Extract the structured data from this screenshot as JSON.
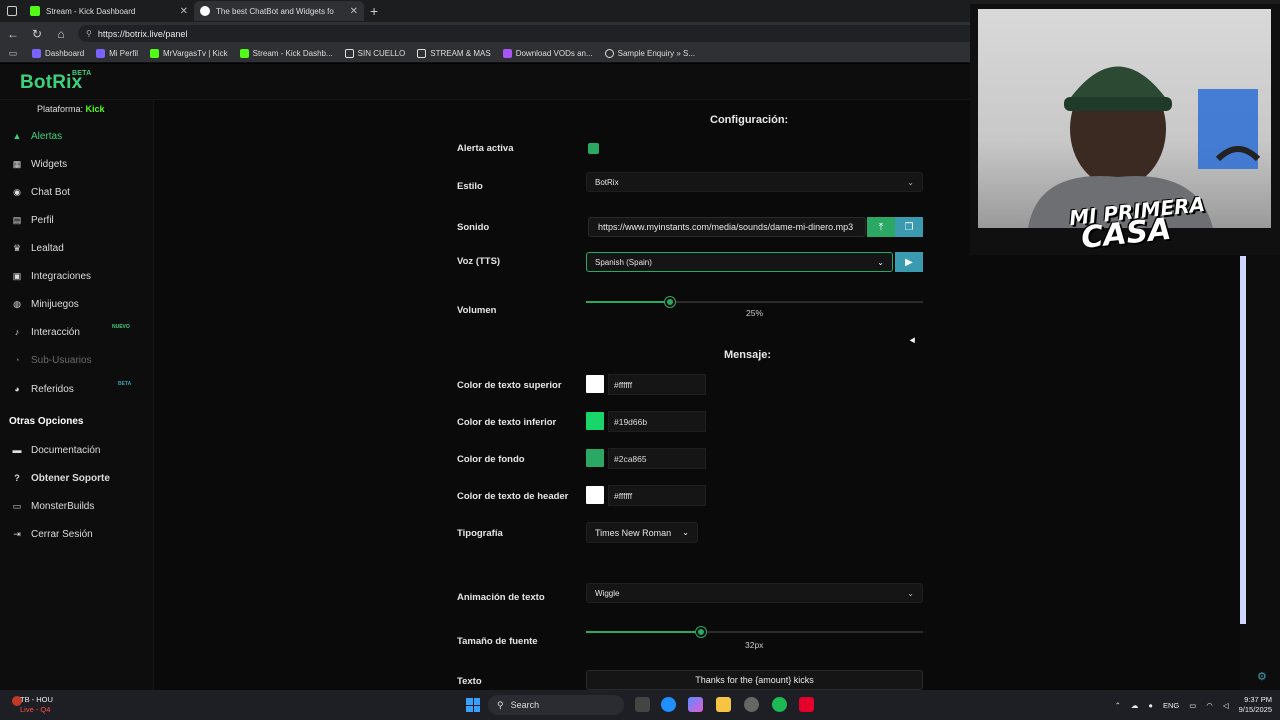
{
  "browser": {
    "tabs": [
      {
        "title": "Stream - Kick Dashboard",
        "favicon_color": "#53fc18"
      },
      {
        "title": "The best ChatBot and Widgets fo",
        "favicon_color": "#ffffff"
      }
    ],
    "url": "https://botrix.live/panel",
    "bookmarks": [
      {
        "label": "Dashboard",
        "icon": "botrix-icon",
        "color": "#7b61ff"
      },
      {
        "label": "Mi Perfil",
        "icon": "botrix-icon",
        "color": "#7b61ff"
      },
      {
        "label": "MrVargasTv | Kick",
        "icon": "kick-icon",
        "color": "#53fc18"
      },
      {
        "label": "Stream - Kick Dashb...",
        "icon": "kick-icon",
        "color": "#53fc18"
      },
      {
        "label": "SIN CUELLO",
        "icon": "folder-icon",
        "color": "#dddddd"
      },
      {
        "label": "STREAM & MAS",
        "icon": "folder-icon",
        "color": "#dddddd"
      },
      {
        "label": "Download VODs an...",
        "icon": "download-icon",
        "color": "#a855f7"
      },
      {
        "label": "Sample Enquiry » S...",
        "icon": "globe-icon",
        "color": "#dddddd"
      }
    ]
  },
  "app": {
    "logo": "BotRix",
    "logo_badge": "BETA",
    "platform_label": "Plataforma:",
    "platform_value": "Kick",
    "brand_color": "#2ca865"
  },
  "sidebar": {
    "items": [
      {
        "label": "Alertas",
        "icon": "alert-icon",
        "state": "active"
      },
      {
        "label": "Widgets",
        "icon": "widgets-icon"
      },
      {
        "label": "Chat Bot",
        "icon": "robot-icon"
      },
      {
        "label": "Perfil",
        "icon": "profile-icon"
      },
      {
        "label": "Lealtad",
        "icon": "trophy-icon"
      },
      {
        "label": "Integraciones",
        "icon": "integrations-icon"
      },
      {
        "label": "Minijuegos",
        "icon": "gamepad-icon"
      },
      {
        "label": "Interacción",
        "icon": "interaction-icon",
        "badge": "NUEVO"
      },
      {
        "label": "Sub-Usuarios",
        "icon": "users-icon",
        "state": "disabled"
      },
      {
        "label": "Referidos",
        "icon": "referrals-icon",
        "badge": "BETA"
      }
    ],
    "section_title": "Otras Opciones",
    "other": [
      {
        "label": "Documentación",
        "icon": "document-icon"
      },
      {
        "label": "Obtener Soporte",
        "icon": "help-icon"
      },
      {
        "label": "MonsterBuilds",
        "icon": "laptop-icon"
      },
      {
        "label": "Cerrar Sesión",
        "icon": "logout-icon"
      }
    ]
  },
  "config": {
    "title": "Configuración:",
    "active_alert_label": "Alerta activa",
    "active_alert_checked": true,
    "style_label": "Estilo",
    "style_value": "BotRix",
    "sound_label": "Sonido",
    "sound_value": "https://www.myinstants.com/media/sounds/dame-mi-dinero.mp3",
    "voice_label": "Voz (TTS)",
    "voice_value": "Spanish (Spain)",
    "volume_label": "Volumen",
    "volume_value": "25%",
    "volume_fraction": 0.25
  },
  "message": {
    "title": "Mensaje:",
    "colors": [
      {
        "label": "Color de texto superior",
        "hex": "#ffffff"
      },
      {
        "label": "Color de texto inferior",
        "hex": "#19d66b"
      },
      {
        "label": "Color de fondo",
        "hex": "#2ca865"
      },
      {
        "label": "Color de texto de header",
        "hex": "#ffffff"
      }
    ],
    "font_label": "Tipografía",
    "font_value": "Times New Roman",
    "animation_label": "Animación de texto",
    "animation_value": "Wiggle",
    "font_size_label": "Tamaño de fuente",
    "font_size_value": "32px",
    "font_size_fraction": 0.34,
    "text_label": "Texto",
    "text_value": "Thanks for the {amount} kicks"
  },
  "webcam": {
    "overlay_line1": "MI PRIMERA",
    "overlay_line2": "CASA"
  },
  "taskbar": {
    "weather_title": "TB - HOU",
    "weather_sub": "Live - Q4",
    "search_label": "Search",
    "language": "ENG",
    "time": "9:37 PM",
    "date": "9/15/2025"
  }
}
